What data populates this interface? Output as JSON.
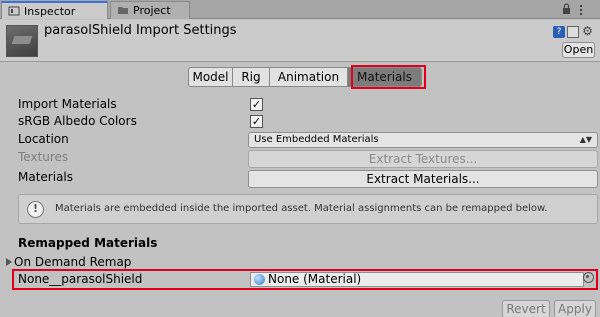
{
  "tabs": [
    {
      "label": "Inspector",
      "icon": "info-icon"
    },
    {
      "label": "Project",
      "icon": "folder-icon"
    }
  ],
  "header": {
    "title": "parasolShield Import Settings",
    "open_label": "Open"
  },
  "toolbar": {
    "items": [
      "Model",
      "Rig",
      "Animation",
      "Materials"
    ],
    "active": "Materials"
  },
  "fields": {
    "import_materials": {
      "label": "Import Materials",
      "checked": true
    },
    "srgb_albedo": {
      "label": "sRGB Albedo Colors",
      "checked": true
    },
    "location": {
      "label": "Location",
      "value": "Use Embedded Materials"
    },
    "textures": {
      "label": "Textures",
      "button": "Extract Textures..."
    },
    "materials": {
      "label": "Materials",
      "button": "Extract Materials..."
    }
  },
  "info_message": "Materials are embedded inside the imported asset. Material assignments can be remapped below.",
  "remapped": {
    "title": "Remapped Materials",
    "foldout": "On Demand Remap",
    "row_label": "None__parasolShield",
    "row_value": "None (Material)"
  },
  "footer": {
    "revert_label": "Revert",
    "apply_label": "Apply"
  },
  "colors": {
    "highlight": "#e0001b",
    "tab_accent": "#3a72d8"
  }
}
